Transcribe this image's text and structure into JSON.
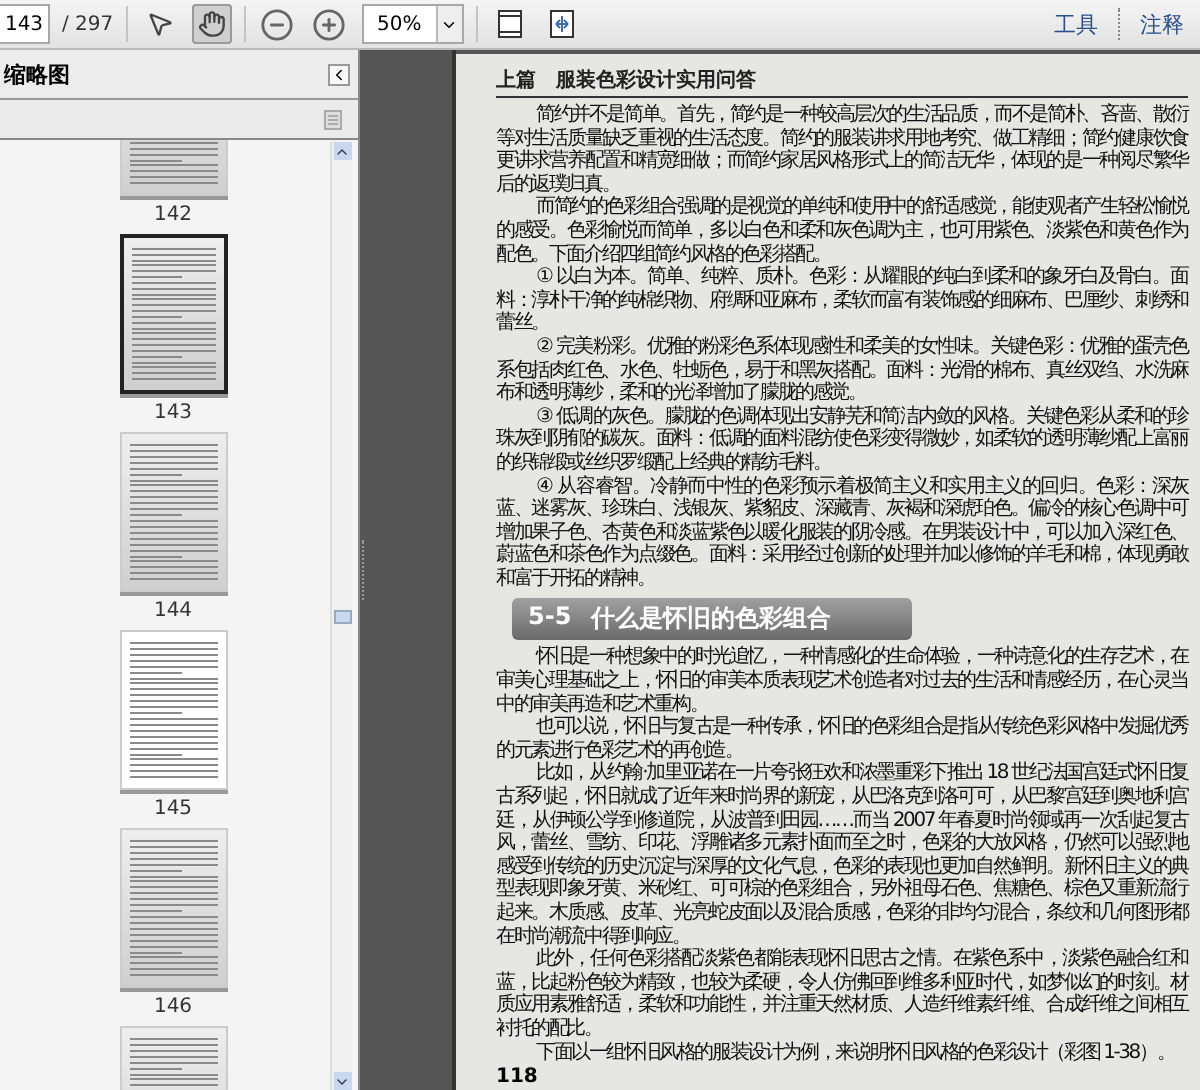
{
  "toolbar": {
    "page_number": "143",
    "page_count": "/ 297",
    "tools": [
      {
        "kind": "select",
        "selected": false
      },
      {
        "kind": "hand",
        "selected": true
      }
    ],
    "zoom": "50%",
    "links": [
      "工具",
      "注释"
    ]
  },
  "sidebar": {
    "title": "缩略图",
    "thumbnails": [
      {
        "kind": "gray",
        "label": "142",
        "selected": false
      },
      {
        "kind": "gray",
        "label": "143",
        "selected": true
      },
      {
        "kind": "gray",
        "label": "144",
        "selected": false
      },
      {
        "kind": "white",
        "label": "145",
        "selected": false
      },
      {
        "kind": "gray",
        "label": "146",
        "selected": false
      },
      {
        "kind": "gray",
        "selected": false
      }
    ]
  },
  "document": {
    "running_head": "上篇　服装色彩设计实用问答",
    "blocks": [
      {
        "kind": "paragraph",
        "text": "简约并不是简单。首先，简约是一种较高层次的生活品质，而不是简朴、吝啬、散衍等对生活质量缺乏重视的生活态度。简约的服装讲求用地考究、做工精细；简约健康饮食更讲求营养配置和精宽细做；而简约家居风格形式上的简洁无华，体现的是一种阅尽繁华后的返璞归真。"
      },
      {
        "kind": "paragraph",
        "text": "而简约的色彩组合强调的是视觉的单纯和使用中的舒适感觉，能使观者产生轻松愉悦的感受。色彩愉悦而简单，多以白色和柔和灰色调为主，也可用紫色、淡紫色和黄色作为配色。下面介绍四组简约风格的色彩搭配。"
      },
      {
        "kind": "paragraph",
        "text": "① 以白为本。简单、纯粹、质朴。色彩：从耀眼的纯白到柔和的象牙白及骨白。面料：淳朴干净的纯棉织物、府绸和亚麻布，柔软而富有装饰感的细麻布、巴厘纱、刺绣和蕾丝。"
      },
      {
        "kind": "paragraph",
        "text": "② 完美粉彩。优雅的粉彩色系体现感性和柔美的女性味。关键色彩：优雅的蛋壳色系包括肉红色、水色、牡蛎色，易于和黑灰搭配。面料：光滑的棉布、真丝双绉、水洗麻布和透明薄纱，柔和的光泽增加了朦胧的感觉。"
      },
      {
        "kind": "paragraph",
        "text": "③ 低调的灰色。朦胧的色调体现出安静芜和简洁内敛的风格。关键色彩从柔和的珍珠灰到阴郁的碳灰。面料：低调的面料混纺使色彩变得微妙，如柔软的透明薄纱配上富丽的织锦缎或丝织罗缎配上经典的精纺毛料。"
      },
      {
        "kind": "paragraph",
        "text": "④ 从容睿智。冷静而中性的色彩预示着极简主义和实用主义的回归。色彩：深灰蓝、迷雾灰、珍珠白、浅银灰、紫貂皮、深藏青、灰褐和深琥珀色。偏冷的核心色调中可增加果子色、杏黄色和淡蓝紫色以暖化服装的阴冷感。在男装设计中，可以加入深红色、蔚蓝色和茶色作为点缀色。面料：采用经过创新的处理并加以修饰的羊毛和棉，体现勇敢和富于开拓的精神。"
      },
      {
        "kind": "heading",
        "number": "5-5",
        "title": "什么是怀旧的色彩组合"
      },
      {
        "kind": "paragraph",
        "text": "怀旧是一种想象中的时光追忆，一种情感化的生命体验，一种诗意化的生存艺术，在审美心理基础之上，怀旧的审美本质表现艺术创造者对过去的生活和情感经历，在心灵当中的审美再造和艺术重构。"
      },
      {
        "kind": "paragraph",
        "text": "也可以说，怀旧与复古是一种传承，怀旧的色彩组合是指从传统色彩风格中发掘优秀的元素进行色彩艺术的再创造。"
      },
      {
        "kind": "paragraph",
        "text": "比如，从约翰·加里亚诺在一片夸张狂欢和浓墨重彩下推出 18 世纪法国宫廷式怀旧复古系列起，怀旧就成了近年来时尚界的新宠，从巴洛克到洛可可，从巴黎宫廷到奥地利宫廷，从伊顿公学到修道院，从波普到田园……而当 2007 年春夏时尚领域再一次刮起复古风，蕾丝、雪纺、印花、浮雕诸多元素扑面而至之时，色彩的大放风格，仍然可以强烈地感受到传统的历史沉淀与深厚的文化气息，色彩的表现也更加自然鲜明。新怀旧主义的典型表现即象牙黄、米砂红、可可棕的色彩组合，另外祖母石色、焦糖色、棕色又重新流行起来。木质感、皮革、光亮蛇皮面以及混合质感，色彩的非均匀混合，条纹和几何图形都在时尚潮流中得到响应。"
      },
      {
        "kind": "paragraph",
        "text": "此外，任何色彩搭配淡紫色都能表现怀旧思古之情。在紫色系中，淡紫色融合红和蓝，比起粉色较为精致，也较为柔硬，令人仿佛回到维多利亚时代，如梦似幻的时刻。材质应用素雅舒适，柔软和功能性，并注重天然材质、人造纤维素纤维、合成纤维之间相互衬托的配比。"
      },
      {
        "kind": "paragraph",
        "text": "下面以一组怀旧风格的服装设计为例，来说明怀旧风格的色彩设计（彩图 1-38）。"
      }
    ],
    "page_number": "118"
  }
}
